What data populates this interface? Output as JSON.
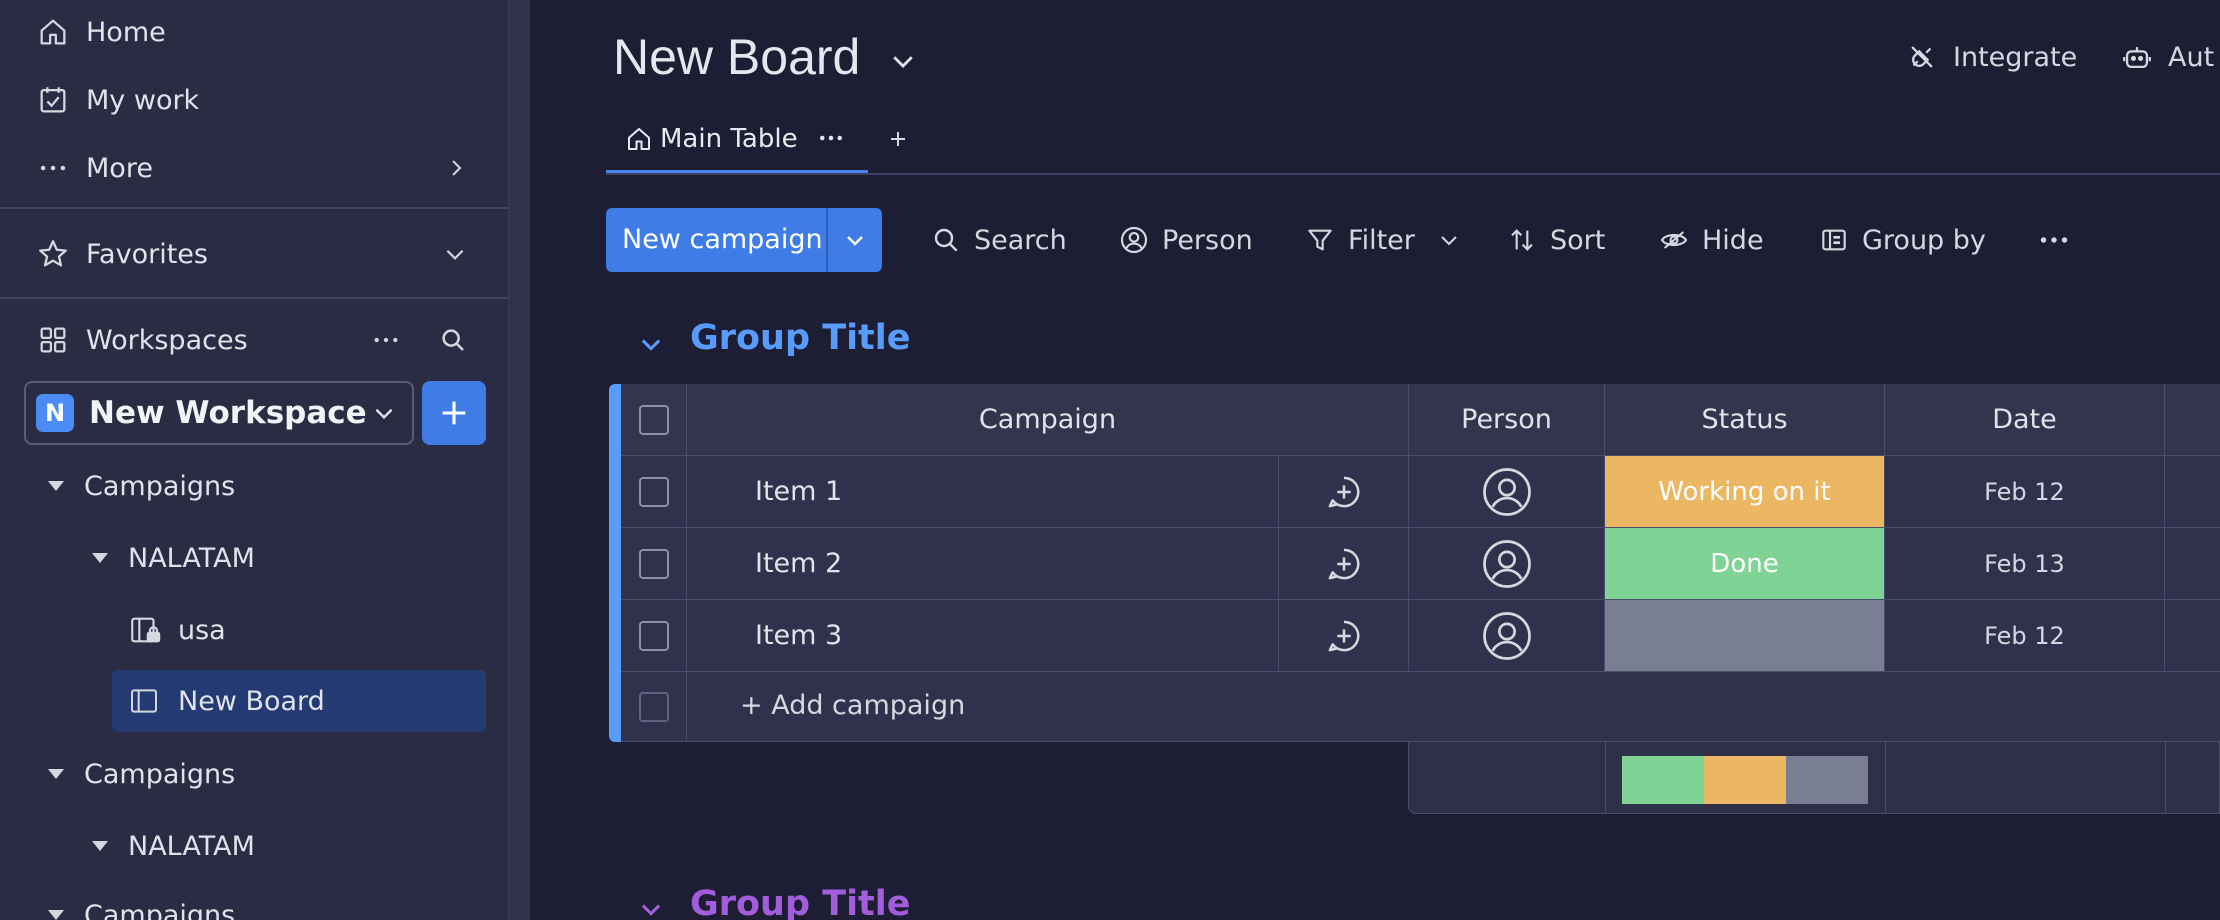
{
  "sidebar": {
    "nav": {
      "home": "Home",
      "my_work": "My work",
      "more": "More"
    },
    "favorites_label": "Favorites",
    "workspaces_label": "Workspaces",
    "workspace": {
      "badge": "N",
      "name": "New Workspace"
    },
    "tree": [
      {
        "label": "Campaigns"
      },
      {
        "label": "NALATAM"
      },
      {
        "label": "usa"
      },
      {
        "label": "New Board"
      },
      {
        "label": "Campaigns"
      },
      {
        "label": "NALATAM"
      },
      {
        "label": "Campaigns"
      }
    ]
  },
  "board": {
    "title": "New Board",
    "integrate_label": "Integrate",
    "automate_label": "Aut",
    "tabs": [
      {
        "label": "Main Table"
      }
    ]
  },
  "toolbar": {
    "new_label": "New campaign",
    "search": "Search",
    "person": "Person",
    "filter": "Filter",
    "sort": "Sort",
    "hide": "Hide",
    "group_by": "Group by"
  },
  "groups": [
    {
      "title": "Group Title",
      "color": "#579bfc"
    },
    {
      "title": "Group Title",
      "color": "#a25ddc"
    }
  ],
  "table": {
    "columns": [
      "Campaign",
      "Person",
      "Status",
      "Date"
    ],
    "rows": [
      {
        "name": "Item 1",
        "status": "Working on it",
        "status_color": "#fdbc64",
        "date": "Feb 12"
      },
      {
        "name": "Item 2",
        "status": "Done",
        "status_color": "#00c875",
        "date": "Feb 13"
      },
      {
        "name": "Item 3",
        "status": "",
        "status_color": "#797e93",
        "date": "Feb 12"
      }
    ],
    "add_row_label": "+ Add campaign",
    "status_summary": [
      {
        "status": "Done",
        "fraction": 0.333,
        "color": "#7fd394"
      },
      {
        "status": "Working on it",
        "fraction": 0.333,
        "color": "#ebb762"
      },
      {
        "status": "",
        "fraction": 0.334,
        "color": "#797e93"
      }
    ]
  },
  "colors": {
    "accent": "#3f7ce6",
    "background": "#1d1e34",
    "sidebar": "#2b2c44",
    "working_on_it": "#ebb762",
    "done": "#7fd394",
    "empty": "#797e93"
  }
}
